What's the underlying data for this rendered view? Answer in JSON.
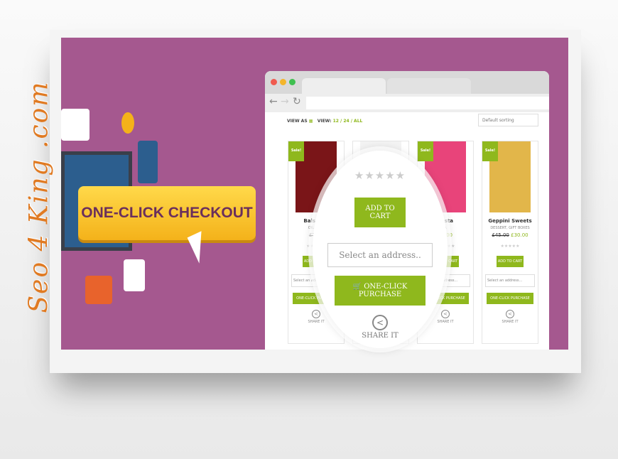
{
  "watermark": "Seo 4 King .com",
  "banner": {
    "title": "ONE-CLICK CHECKOUT"
  },
  "browser": {
    "toolbar": {
      "view_as": "VIEW AS",
      "view": "VIEW:",
      "view_options": "12 / 24 / ALL"
    },
    "sorting": "Default sorting"
  },
  "products": [
    {
      "badge": "Sale!",
      "name": "Balsamic",
      "category": "OIL, AND",
      "price_old": "£7.00",
      "price_new": "",
      "stars": "★★★★★",
      "add_to_cart": "ADD TO CART",
      "address_placeholder": "Select an address...",
      "purchase": "ONE-CLICK PURCHASE",
      "share": "SHARE IT"
    },
    {
      "badge": "",
      "name": "",
      "category": "",
      "price_old": "",
      "price_new": "",
      "stars": "",
      "add_to_cart": "",
      "address_placeholder": "",
      "purchase": "",
      "share": "SHARE IT"
    },
    {
      "badge": "Sale!",
      "name": "pasta",
      "category": "A",
      "price_old": "",
      "price_new": "£6.00",
      "stars": "★★★★★",
      "add_to_cart": "ADD TO CART",
      "address_placeholder": "Select an address...",
      "purchase": "ONE-CLICK PURCHASE",
      "share": "SHARE IT"
    },
    {
      "badge": "Sale!",
      "name": "Geppini Sweets",
      "category": "DESSERT, GIFT BOXES",
      "price_old": "£45.00",
      "price_new": "£30.00",
      "stars": "★★★★★",
      "add_to_cart": "ADD TO CART",
      "address_placeholder": "Select an address...",
      "purchase": "ONE-CLICK PURCHASE",
      "share": "SHARE IT"
    }
  ],
  "magnifier": {
    "stars": "★★★★★",
    "add_to_cart": "ADD TO CART",
    "address_placeholder": "Select an address..",
    "purchase": "ONE-CLICK PURCHASE",
    "share": "SHARE IT"
  },
  "colors": {
    "purple": "#a5588f",
    "green": "#8fb81d",
    "yellow": "#f4b21a"
  }
}
